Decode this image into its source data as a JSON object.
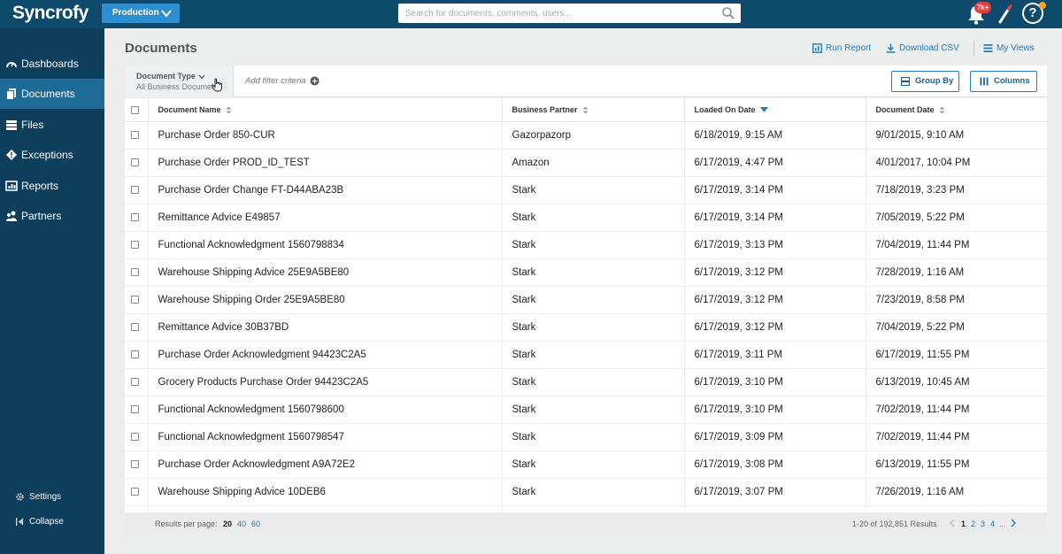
{
  "app": {
    "logo": "Syncrofy"
  },
  "topbar": {
    "environment": "Production",
    "search_placeholder": "Search for documents, comments, users...",
    "notification_badge": "7k+",
    "help_label": "?"
  },
  "sidebar": {
    "items": [
      {
        "label": "Dashboards",
        "icon": "dashboard-icon"
      },
      {
        "label": "Documents",
        "icon": "documents-icon",
        "active": true
      },
      {
        "label": "Files",
        "icon": "files-icon"
      },
      {
        "label": "Exceptions",
        "icon": "exceptions-icon"
      },
      {
        "label": "Reports",
        "icon": "reports-icon"
      },
      {
        "label": "Partners",
        "icon": "partners-icon"
      }
    ],
    "settings": "Settings",
    "collapse": "Collapse"
  },
  "main": {
    "title": "Documents",
    "actions": {
      "run_report": "Run Report",
      "download_csv": "Download CSV",
      "my_views": "My Views"
    },
    "filter": {
      "doc_type_label": "Document Type",
      "doc_type_value": "All Business Documents",
      "add_filter": "Add filter criteria"
    },
    "group_by": "Group By",
    "columns_btn": "Columns"
  },
  "table": {
    "headers": [
      "Document Name",
      "Business Partner",
      "Loaded On Date",
      "Document Date"
    ],
    "rows": [
      [
        "Purchase Order 850-CUR",
        "Gazorpazorp",
        "6/18/2019, 9:15 AM",
        "9/01/2015, 9:10 AM"
      ],
      [
        "Purchase Order PROD_ID_TEST",
        "Amazon",
        "6/17/2019, 4:47 PM",
        "4/01/2017, 10:04 PM"
      ],
      [
        "Purchase Order Change FT-D44ABA23B",
        "Stark",
        "6/17/2019, 3:14 PM",
        "7/18/2019, 3:23 PM"
      ],
      [
        "Remittance Advice E49857",
        "Stark",
        "6/17/2019, 3:14 PM",
        "7/05/2019, 5:22 PM"
      ],
      [
        "Functional Acknowledgment 1560798834",
        "Stark",
        "6/17/2019, 3:13 PM",
        "7/04/2019, 11:44 PM"
      ],
      [
        "Warehouse Shipping Advice 25E9A5BE80",
        "Stark",
        "6/17/2019, 3:12 PM",
        "7/28/2019, 1:16 AM"
      ],
      [
        "Warehouse Shipping Order 25E9A5BE80",
        "Stark",
        "6/17/2019, 3:12 PM",
        "7/23/2019, 8:58 PM"
      ],
      [
        "Remittance Advice 30B37BD",
        "Stark",
        "6/17/2019, 3:12 PM",
        "7/04/2019, 5:22 PM"
      ],
      [
        "Purchase Order Acknowledgment 94423C2A5",
        "Stark",
        "6/17/2019, 3:11 PM",
        "6/17/2019, 11:55 PM"
      ],
      [
        "Grocery Products Purchase Order 94423C2A5",
        "Stark",
        "6/17/2019, 3:10 PM",
        "6/13/2019, 10:45 AM"
      ],
      [
        "Functional Acknowledgment 1560798600",
        "Stark",
        "6/17/2019, 3:10 PM",
        "7/02/2019, 11:44 PM"
      ],
      [
        "Functional Acknowledgment 1560798547",
        "Stark",
        "6/17/2019, 3:09 PM",
        "7/02/2019, 11:44 PM"
      ],
      [
        "Purchase Order Acknowledgment A9A72E2",
        "Stark",
        "6/17/2019, 3:08 PM",
        "6/13/2019, 11:55 PM"
      ],
      [
        "Warehouse Shipping Advice 10DEB6",
        "Stark",
        "6/17/2019, 3:07 PM",
        "7/26/2019, 1:16 AM"
      ],
      [
        "",
        "",
        "",
        ""
      ]
    ]
  },
  "footer": {
    "results_per_page_label": "Results per page:",
    "per_page_options": [
      "20",
      "40",
      "60"
    ],
    "per_page_current": "20",
    "results_text": "1-20 of 192,851 Results",
    "pages": [
      "1",
      "2",
      "3",
      "4"
    ],
    "current_page": "1",
    "ellipsis": "..."
  },
  "colors": {
    "topbar": "#0d4a6b",
    "sidebar": "#0d3f5d",
    "sidebar_active": "#1f6b97",
    "environment_button": "#2d8fd1",
    "link": "#1f7dc1",
    "badge": "#e5403c"
  }
}
